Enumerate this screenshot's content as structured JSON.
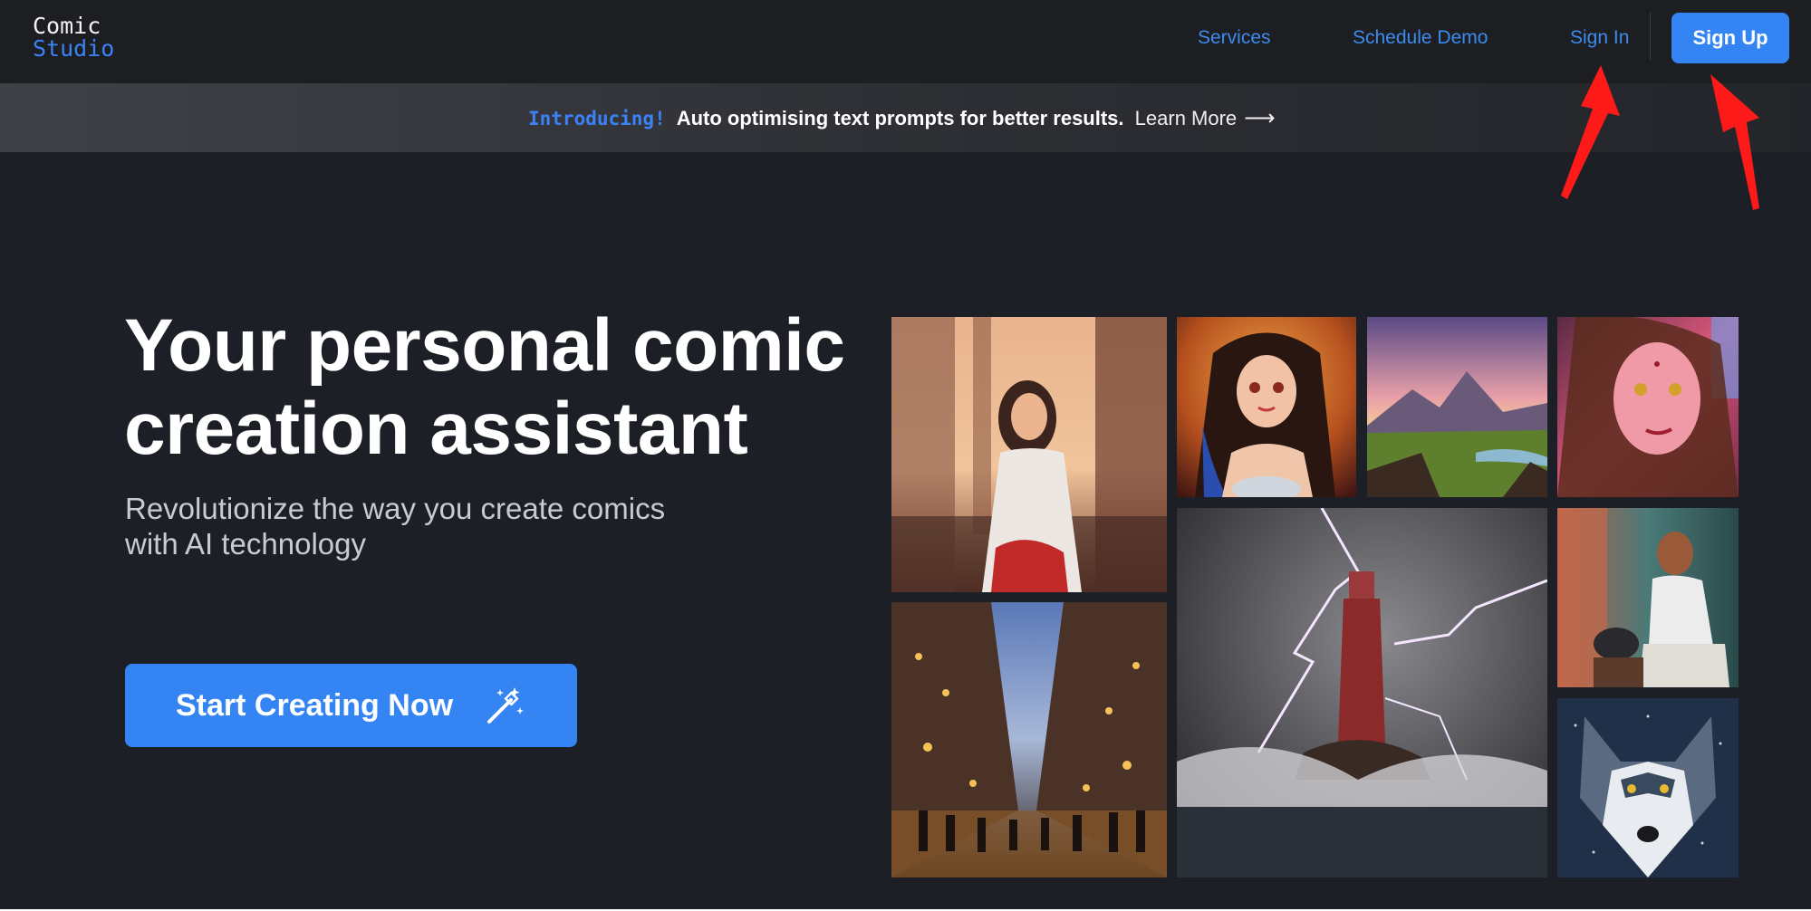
{
  "brand": {
    "line1": "Comic",
    "line2": "Studio"
  },
  "nav": {
    "services": "Services",
    "schedule_demo": "Schedule Demo",
    "sign_in": "Sign In",
    "sign_up": "Sign Up"
  },
  "banner": {
    "tag": "Introducing!",
    "message": "Auto optimising text prompts for better results.",
    "link": "Learn More",
    "arrow_icon": "long-arrow-right-icon"
  },
  "hero": {
    "title": "Your personal comic creation assistant",
    "subtitle": "Revolutionize the way you create comics with AI technology",
    "cta": "Start Creating Now",
    "cta_icon": "magic-wand-icon"
  },
  "gallery": [
    {
      "name": "woman-in-temple-image"
    },
    {
      "name": "anime-woman-portrait-image"
    },
    {
      "name": "mountain-valley-sunset-image"
    },
    {
      "name": "pink-portrait-woman-image"
    },
    {
      "name": "night-market-street-image"
    },
    {
      "name": "lighthouse-lightning-image"
    },
    {
      "name": "old-man-tea-image"
    },
    {
      "name": "wolf-portrait-image"
    }
  ],
  "colors": {
    "accent": "#3584f3",
    "page_bg": "#1c1f26",
    "nav_bg": "#1d1e22",
    "annotation": "#ff1a1a"
  }
}
